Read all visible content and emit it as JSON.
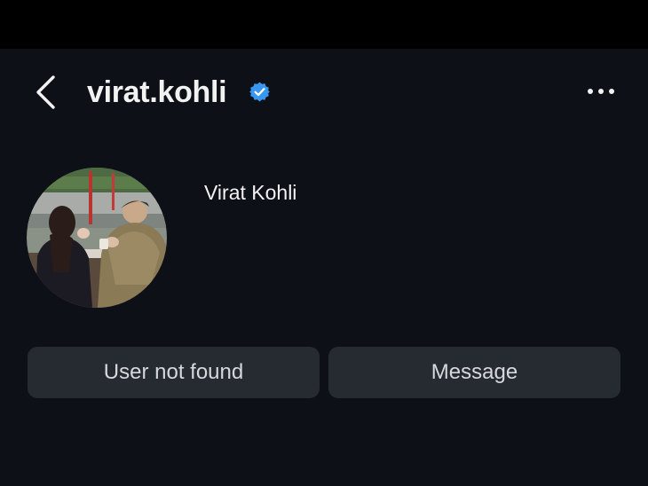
{
  "header": {
    "username": "virat.kohli",
    "back_icon": "chevron-left-icon",
    "verified_icon": "verified-badge-icon",
    "more_icon": "more-horizontal-icon"
  },
  "profile": {
    "display_name": "Virat Kohli",
    "avatar": "profile-photo"
  },
  "actions": {
    "primary_label": "User not found",
    "secondary_label": "Message"
  },
  "colors": {
    "background": "#0d1016",
    "button_bg": "#262a31",
    "verified_blue": "#3897f0",
    "text": "#f2f2f2"
  }
}
